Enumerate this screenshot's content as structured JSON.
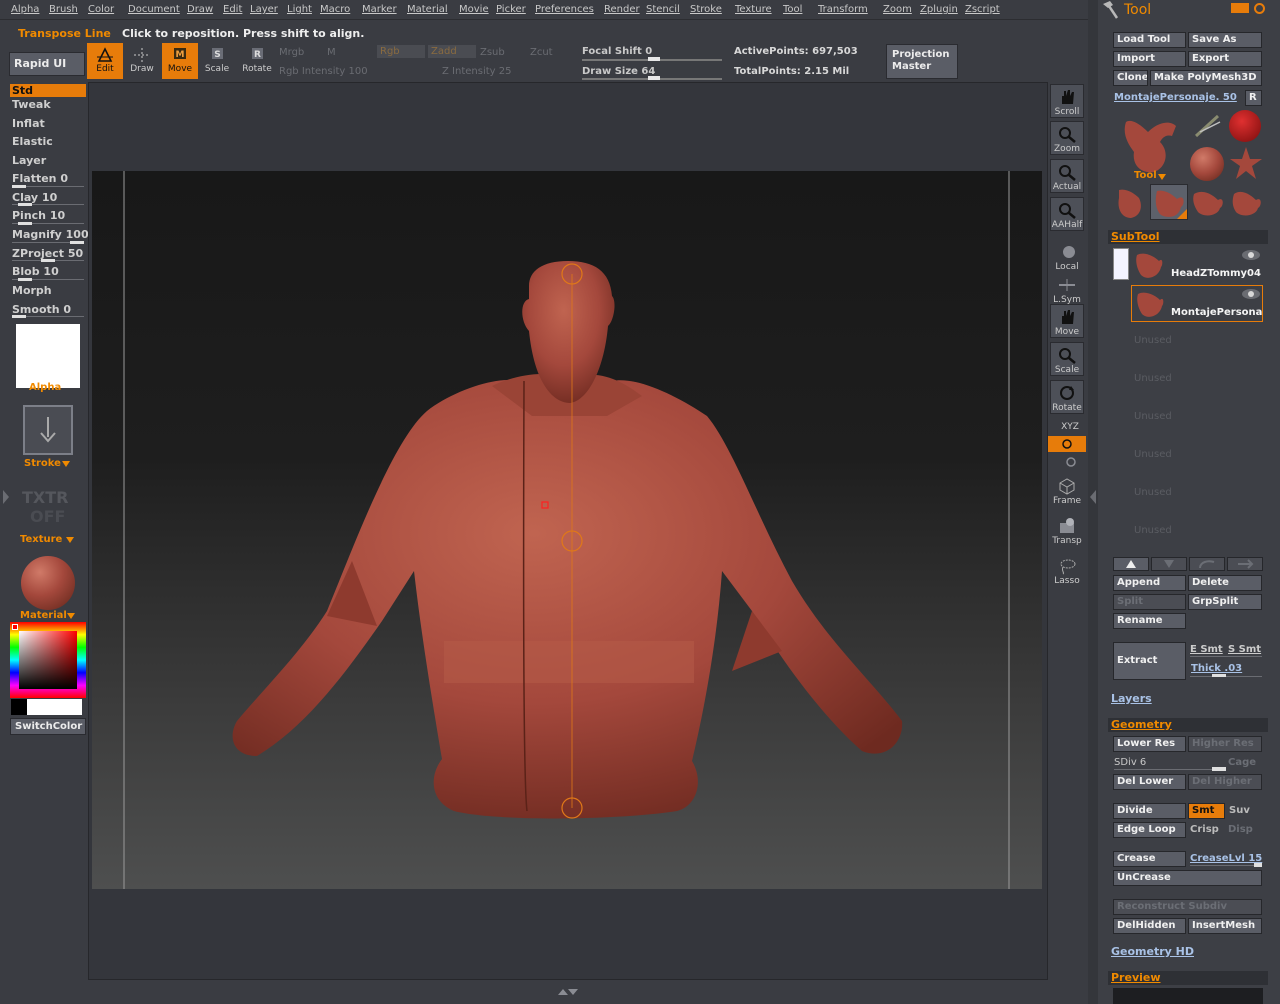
{
  "menu": [
    "Alpha",
    "Brush",
    "Color",
    "Document",
    "Draw",
    "Edit",
    "Layer",
    "Light",
    "Macro",
    "Marker",
    "Material",
    "Movie",
    "Picker",
    "Preferences",
    "Render",
    "Stencil",
    "Stroke",
    "Texture",
    "Tool",
    "Transform",
    "Zoom",
    "Zplugin",
    "Zscript"
  ],
  "status": {
    "mode": "Transpose Line",
    "message": "Click to reposition. Press shift to align."
  },
  "topshelf": {
    "rapid_ui": "Rapid UI",
    "modes": [
      {
        "label": "Edit"
      },
      {
        "label": "Draw"
      },
      {
        "label": "Move"
      },
      {
        "label": "Scale"
      },
      {
        "label": "Rotate"
      }
    ],
    "mrgb": "Mrgb",
    "m": "M",
    "rgb": "Rgb",
    "zadd": "Zadd",
    "zsub": "Zsub",
    "zcut": "Zcut",
    "rgb_intensity": "Rgb Intensity 100",
    "z_intensity": "Z Intensity 25",
    "focal_shift": "Focal Shift 0",
    "draw_size": "Draw Size 64",
    "active_points": "ActivePoints: 697,503",
    "total_points": "TotalPoints: 2.15 Mil",
    "projection_master": "Projection Master"
  },
  "brushes": [
    {
      "label": "Std",
      "active": true
    },
    {
      "label": "Tweak"
    },
    {
      "label": "Inflat"
    },
    {
      "label": "Elastic"
    },
    {
      "label": "Layer"
    },
    {
      "label": "Flatten 0",
      "slider": 0.0
    },
    {
      "label": "Clay 10",
      "slider": 0.1
    },
    {
      "label": "Pinch 10",
      "slider": 0.1
    },
    {
      "label": "Magnify 100",
      "slider": 1.0
    },
    {
      "label": "ZProject 50",
      "slider": 0.5
    },
    {
      "label": "Blob 10",
      "slider": 0.1
    },
    {
      "label": "Morph"
    },
    {
      "label": "Smooth 0",
      "slider": 0.0
    }
  ],
  "left": {
    "alpha": "Alpha",
    "stroke": "Stroke",
    "txtr": "TXTR",
    "txtr_off": "OFF",
    "texture": "Texture",
    "material": "Material",
    "switch_color": "SwitchColor"
  },
  "right_tools": [
    {
      "label": "Scroll",
      "icon": "hand-icon"
    },
    {
      "label": "Zoom",
      "icon": "magnifier-plus-icon"
    },
    {
      "label": "Actual",
      "icon": "magnifier-icon"
    },
    {
      "label": "AAHalf",
      "icon": "magnifier-half-icon"
    },
    {
      "label": "Local",
      "icon": "local-icon"
    },
    {
      "label": "L.Sym",
      "icon": "lsym-icon"
    },
    {
      "label": "Move",
      "icon": "hand-move-icon"
    },
    {
      "label": "Scale",
      "icon": "scale-icon"
    },
    {
      "label": "Rotate",
      "icon": "rotate-icon"
    },
    {
      "label": "XYZ",
      "icon": "xyz-icon"
    },
    {
      "label": "Frame",
      "icon": "frame-icon"
    },
    {
      "label": "Transp",
      "icon": "transp-icon"
    },
    {
      "label": "Lasso",
      "icon": "lasso-icon"
    }
  ],
  "tray": {
    "title": "Tool",
    "load_tool": "Load Tool",
    "save_as": "Save As",
    "import": "Import",
    "export": "Export",
    "clone": "Clone",
    "make_polymesh": "Make PolyMesh3D",
    "current_tool": "MontajePersonaje. 50",
    "r": "R",
    "tool_label": "Tool",
    "subtool_header": "SubTool",
    "subtools": [
      "HeadZTommy04",
      "MontajePersona"
    ],
    "unused": "Unused",
    "append": "Append",
    "delete": "Delete",
    "split": "Split",
    "grpsplit": "GrpSplit",
    "rename": "Rename",
    "extract": "Extract",
    "e_smt": "E Smt",
    "s_smt": "S Smt",
    "thick": "Thick .03",
    "layers": "Layers",
    "geometry_header": "Geometry",
    "lower_res": "Lower Res",
    "higher_res": "Higher Res",
    "sdiv": "SDiv 6",
    "cage": "Cage",
    "del_lower": "Del Lower",
    "del_higher": "Del Higher",
    "divide": "Divide",
    "smt": "Smt",
    "suv": "Suv",
    "edge_loop": "Edge Loop",
    "crisp": "Crisp",
    "disp": "Disp",
    "crease": "Crease",
    "creaselvl": "CreaseLvl 15",
    "uncrease": "UnCrease",
    "reconstruct": "Reconstruct Subdiv",
    "delhidden": "DelHidden",
    "insertmesh": "InsertMesh",
    "geometry_hd": "Geometry HD",
    "preview": "Preview"
  },
  "colors": {
    "accent": "#e77c0a",
    "clay": "#a4483c",
    "button": "#5a5d66"
  }
}
